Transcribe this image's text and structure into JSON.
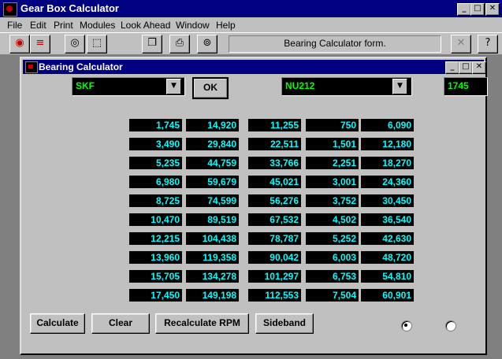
{
  "app": {
    "title": "Gear Box Calculator"
  },
  "menu": [
    {
      "label": "File"
    },
    {
      "label": "Edit"
    },
    {
      "label": "Print"
    },
    {
      "label": "Modules"
    },
    {
      "label": "Look Ahead"
    },
    {
      "label": "Window"
    },
    {
      "label": "Help"
    }
  ],
  "toolbar": {
    "status_text": "Bearing Calculator form.",
    "buttons": [
      "record-icon",
      "grid-icon",
      "target-icon",
      "chart-icon",
      "copy-icon",
      "print-icon",
      "binoculars-icon",
      "close-icon",
      "help-icon"
    ]
  },
  "child": {
    "title": "Bearing Calculator",
    "manufacturer": "SKF",
    "ok_label": "OK",
    "bearing": "NU212",
    "rpm": "1745",
    "table": {
      "columns": [
        [
          "1,745",
          "3,490",
          "5,235",
          "6,980",
          "8,725",
          "10,470",
          "12,215",
          "13,960",
          "15,705",
          "17,450"
        ],
        [
          "14,920",
          "29,840",
          "44,759",
          "59,679",
          "74,599",
          "89,519",
          "104,438",
          "119,358",
          "134,278",
          "149,198"
        ],
        [
          "11,255",
          "22,511",
          "33,766",
          "45,021",
          "56,276",
          "67,532",
          "78,787",
          "90,042",
          "101,297",
          "112,553"
        ],
        [
          "750",
          "1,501",
          "2,251",
          "3,001",
          "3,752",
          "4,502",
          "5,252",
          "6,003",
          "6,753",
          "7,504"
        ],
        [
          "6,090",
          "12,180",
          "18,270",
          "24,360",
          "30,450",
          "36,540",
          "42,630",
          "48,720",
          "54,810",
          "60,901"
        ]
      ]
    },
    "buttons": {
      "calculate": "Calculate",
      "clear": "Clear",
      "recalculate": "Recalculate RPM",
      "sideband": "Sideband"
    },
    "radio": {
      "selected": 0
    }
  },
  "colors": {
    "title_bar": "#000080",
    "field_text": "#00ff00",
    "table_text": "#00ffff"
  }
}
